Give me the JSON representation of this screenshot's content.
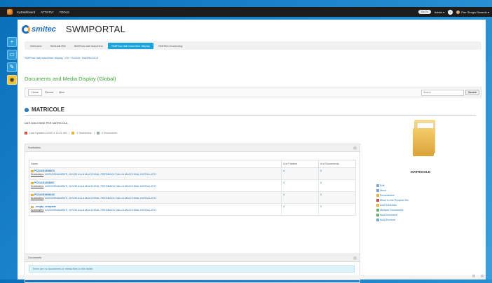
{
  "topbar": {
    "menu": [
      "myDashboard",
      "ATTIVITA'",
      "TOOLS"
    ],
    "goto": "Go To",
    "admin": "Admin ▾",
    "notifications": "0",
    "user": "Pier Giorgio Dassolo ▾"
  },
  "header": {
    "brand": "smitec",
    "portal": "SWMPORTAL"
  },
  "nav": {
    "items": [
      "Welcome",
      "SMILAB RM",
      "SMIFlow dati macchine",
      "SMIFlow dati macchine display",
      "SMITEC ELearning"
    ],
    "active_index": 3
  },
  "breadcrumb": "SMIFlow dati macchine display / SX / SX200 / MATRICOLE",
  "section_title": "Documents and Media Display (Global)",
  "toolbar": {
    "tabs": [
      "Home",
      "Recent",
      "Mine"
    ],
    "search_placeholder": "Search",
    "search_button": "Search"
  },
  "folder": {
    "name": "MATRICOLE",
    "description": "DATI MACCHINE PER MATRICOLA",
    "last_updated": "Last Updated 3/25/14 10:21 AM",
    "subfolders": "4 Subfolders",
    "documents": "0 Documents"
  },
  "subfolders_panel": {
    "heading": "Subfolders",
    "columns": [
      "Name",
      "# of Folders",
      "# of Documents"
    ],
    "rows": [
      {
        "name": "PCS4151358870",
        "folders": "4",
        "documents": "0"
      },
      {
        "name": "PCS4151358807",
        "folders": "4",
        "documents": "0"
      },
      {
        "name": "PCS4151598232",
        "folders": "4",
        "documents": "0"
      },
      {
        "name": "_empty_template",
        "folders": "4",
        "documents": "0"
      }
    ],
    "sub_label": "Subfolders",
    "sub_links": "AGGIORNAMENTI, AVVISI ALLA MACCHINA, FEEDBACK DALLA MACCHINA, INSTALLATO"
  },
  "documents_panel": {
    "heading": "Documents",
    "empty_message": "There are no documents or media files in this folder."
  },
  "right": {
    "label": "MATRICOLE",
    "actions": [
      "Edit",
      "Move",
      "Permissions",
      "Move to the Recycle Bin",
      "Add Subfolder",
      "Multiple Documents",
      "Add Document",
      "Add Shortcut"
    ]
  },
  "icons": {
    "dock": [
      "add-icon",
      "display-icon",
      "edit-icon",
      "eye-icon"
    ]
  }
}
